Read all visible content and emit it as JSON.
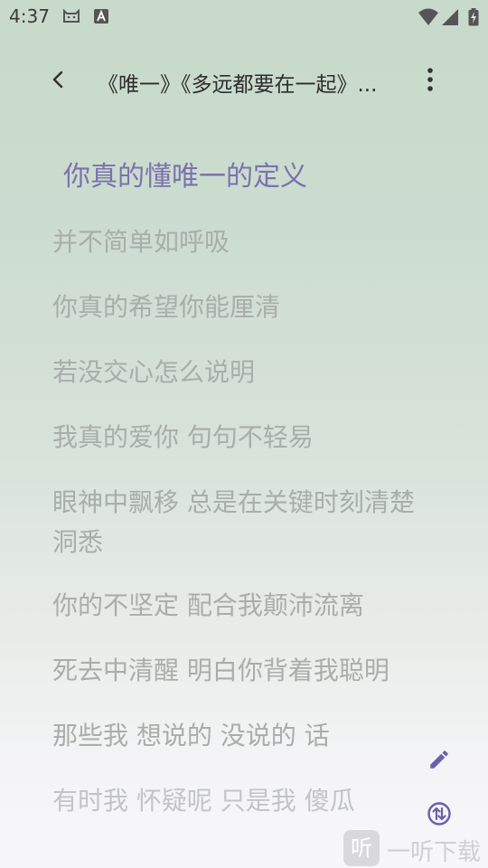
{
  "status_bar": {
    "time": "4:37"
  },
  "toolbar": {
    "title": "《唯一》《多远都要在一起》..."
  },
  "lyrics": {
    "active": "你真的懂唯一的定义",
    "lines": [
      "并不简单如呼吸",
      "你真的希望你能厘清",
      "若没交心怎么说明",
      "我真的爱你 句句不轻易",
      "眼神中飘移 总是在关键时刻清楚洞悉",
      "你的不坚定 配合我颠沛流离",
      "死去中清醒 明白你背着我聪明",
      "那些我 想说的 没说的 话",
      "有时我 怀疑呢 只是我 傻瓜"
    ]
  },
  "icons": {
    "back": "chevron-left-icon",
    "more": "more-vertical-icon",
    "edit": "pencil-icon",
    "translate": "swap-circle-icon"
  },
  "colors": {
    "accent": "#6a5fb0",
    "active_lyric": "#7a73ad",
    "inactive_lyric": "#a8aea9"
  },
  "watermark": {
    "logo": "听",
    "text": "一听下载"
  }
}
